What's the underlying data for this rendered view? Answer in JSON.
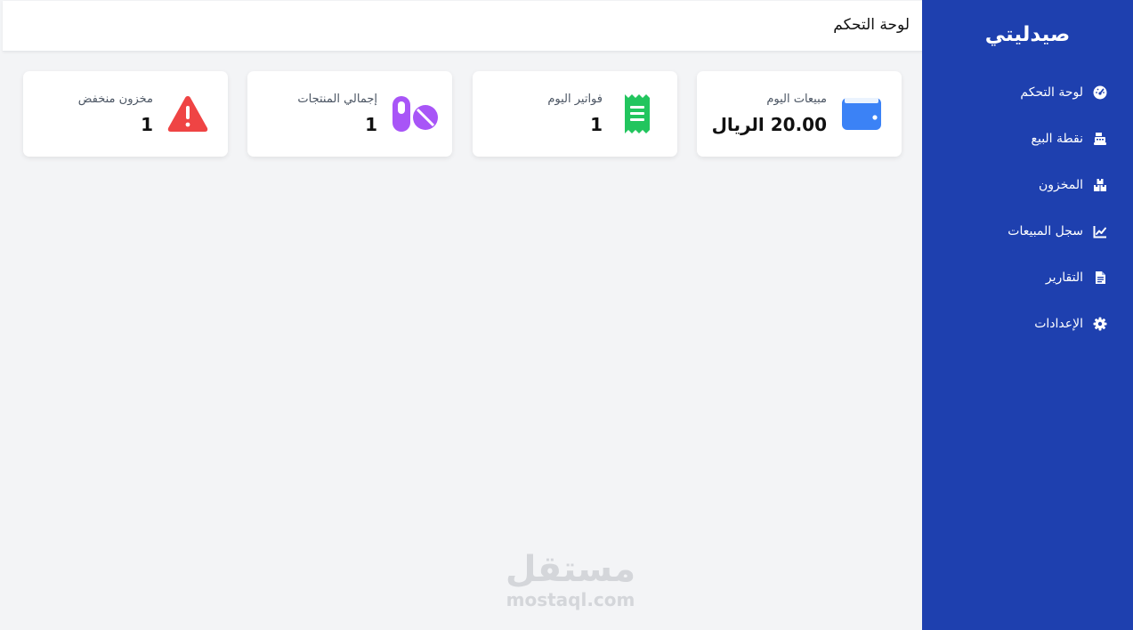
{
  "sidebar": {
    "brand": "صيدليتي",
    "items": [
      {
        "label": "لوحة التحكم",
        "icon": "dashboard-gauge-icon"
      },
      {
        "label": "نقطة البيع",
        "icon": "cash-register-icon"
      },
      {
        "label": "المخزون",
        "icon": "boxes-icon"
      },
      {
        "label": "سجل المبيعات",
        "icon": "chart-line-icon"
      },
      {
        "label": "التقارير",
        "icon": "file-report-icon"
      },
      {
        "label": "الإعدادات",
        "icon": "gear-icon"
      }
    ]
  },
  "header": {
    "title": "لوحة التحكم"
  },
  "cards": [
    {
      "label": "مبيعات اليوم",
      "value": "20.00 الريال",
      "icon": "wallet-icon",
      "color": "#3b82f6"
    },
    {
      "label": "فواتير اليوم",
      "value": "1",
      "icon": "receipt-icon",
      "color": "#22c55e"
    },
    {
      "label": "إجمالي المنتجات",
      "value": "1",
      "icon": "pills-icon",
      "color": "#a855f7"
    },
    {
      "label": "مخزون منخفض",
      "value": "1",
      "icon": "warning-triangle-icon",
      "color": "#ef4444"
    }
  ],
  "watermark": {
    "arabic": "مستقل",
    "url": "mostaql.com"
  }
}
